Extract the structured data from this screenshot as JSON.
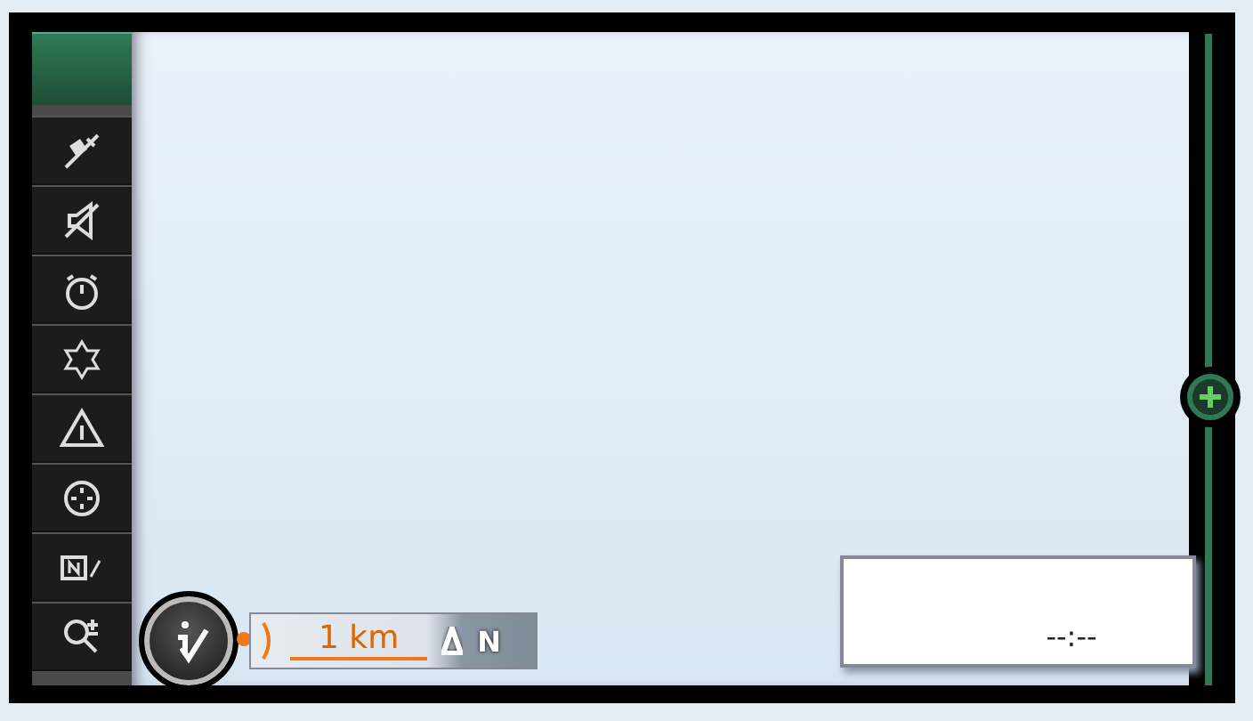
{
  "scale_bar": {
    "label": "1 km"
  },
  "compass": {
    "label": "N"
  },
  "time_box": {
    "value": "--:--"
  }
}
